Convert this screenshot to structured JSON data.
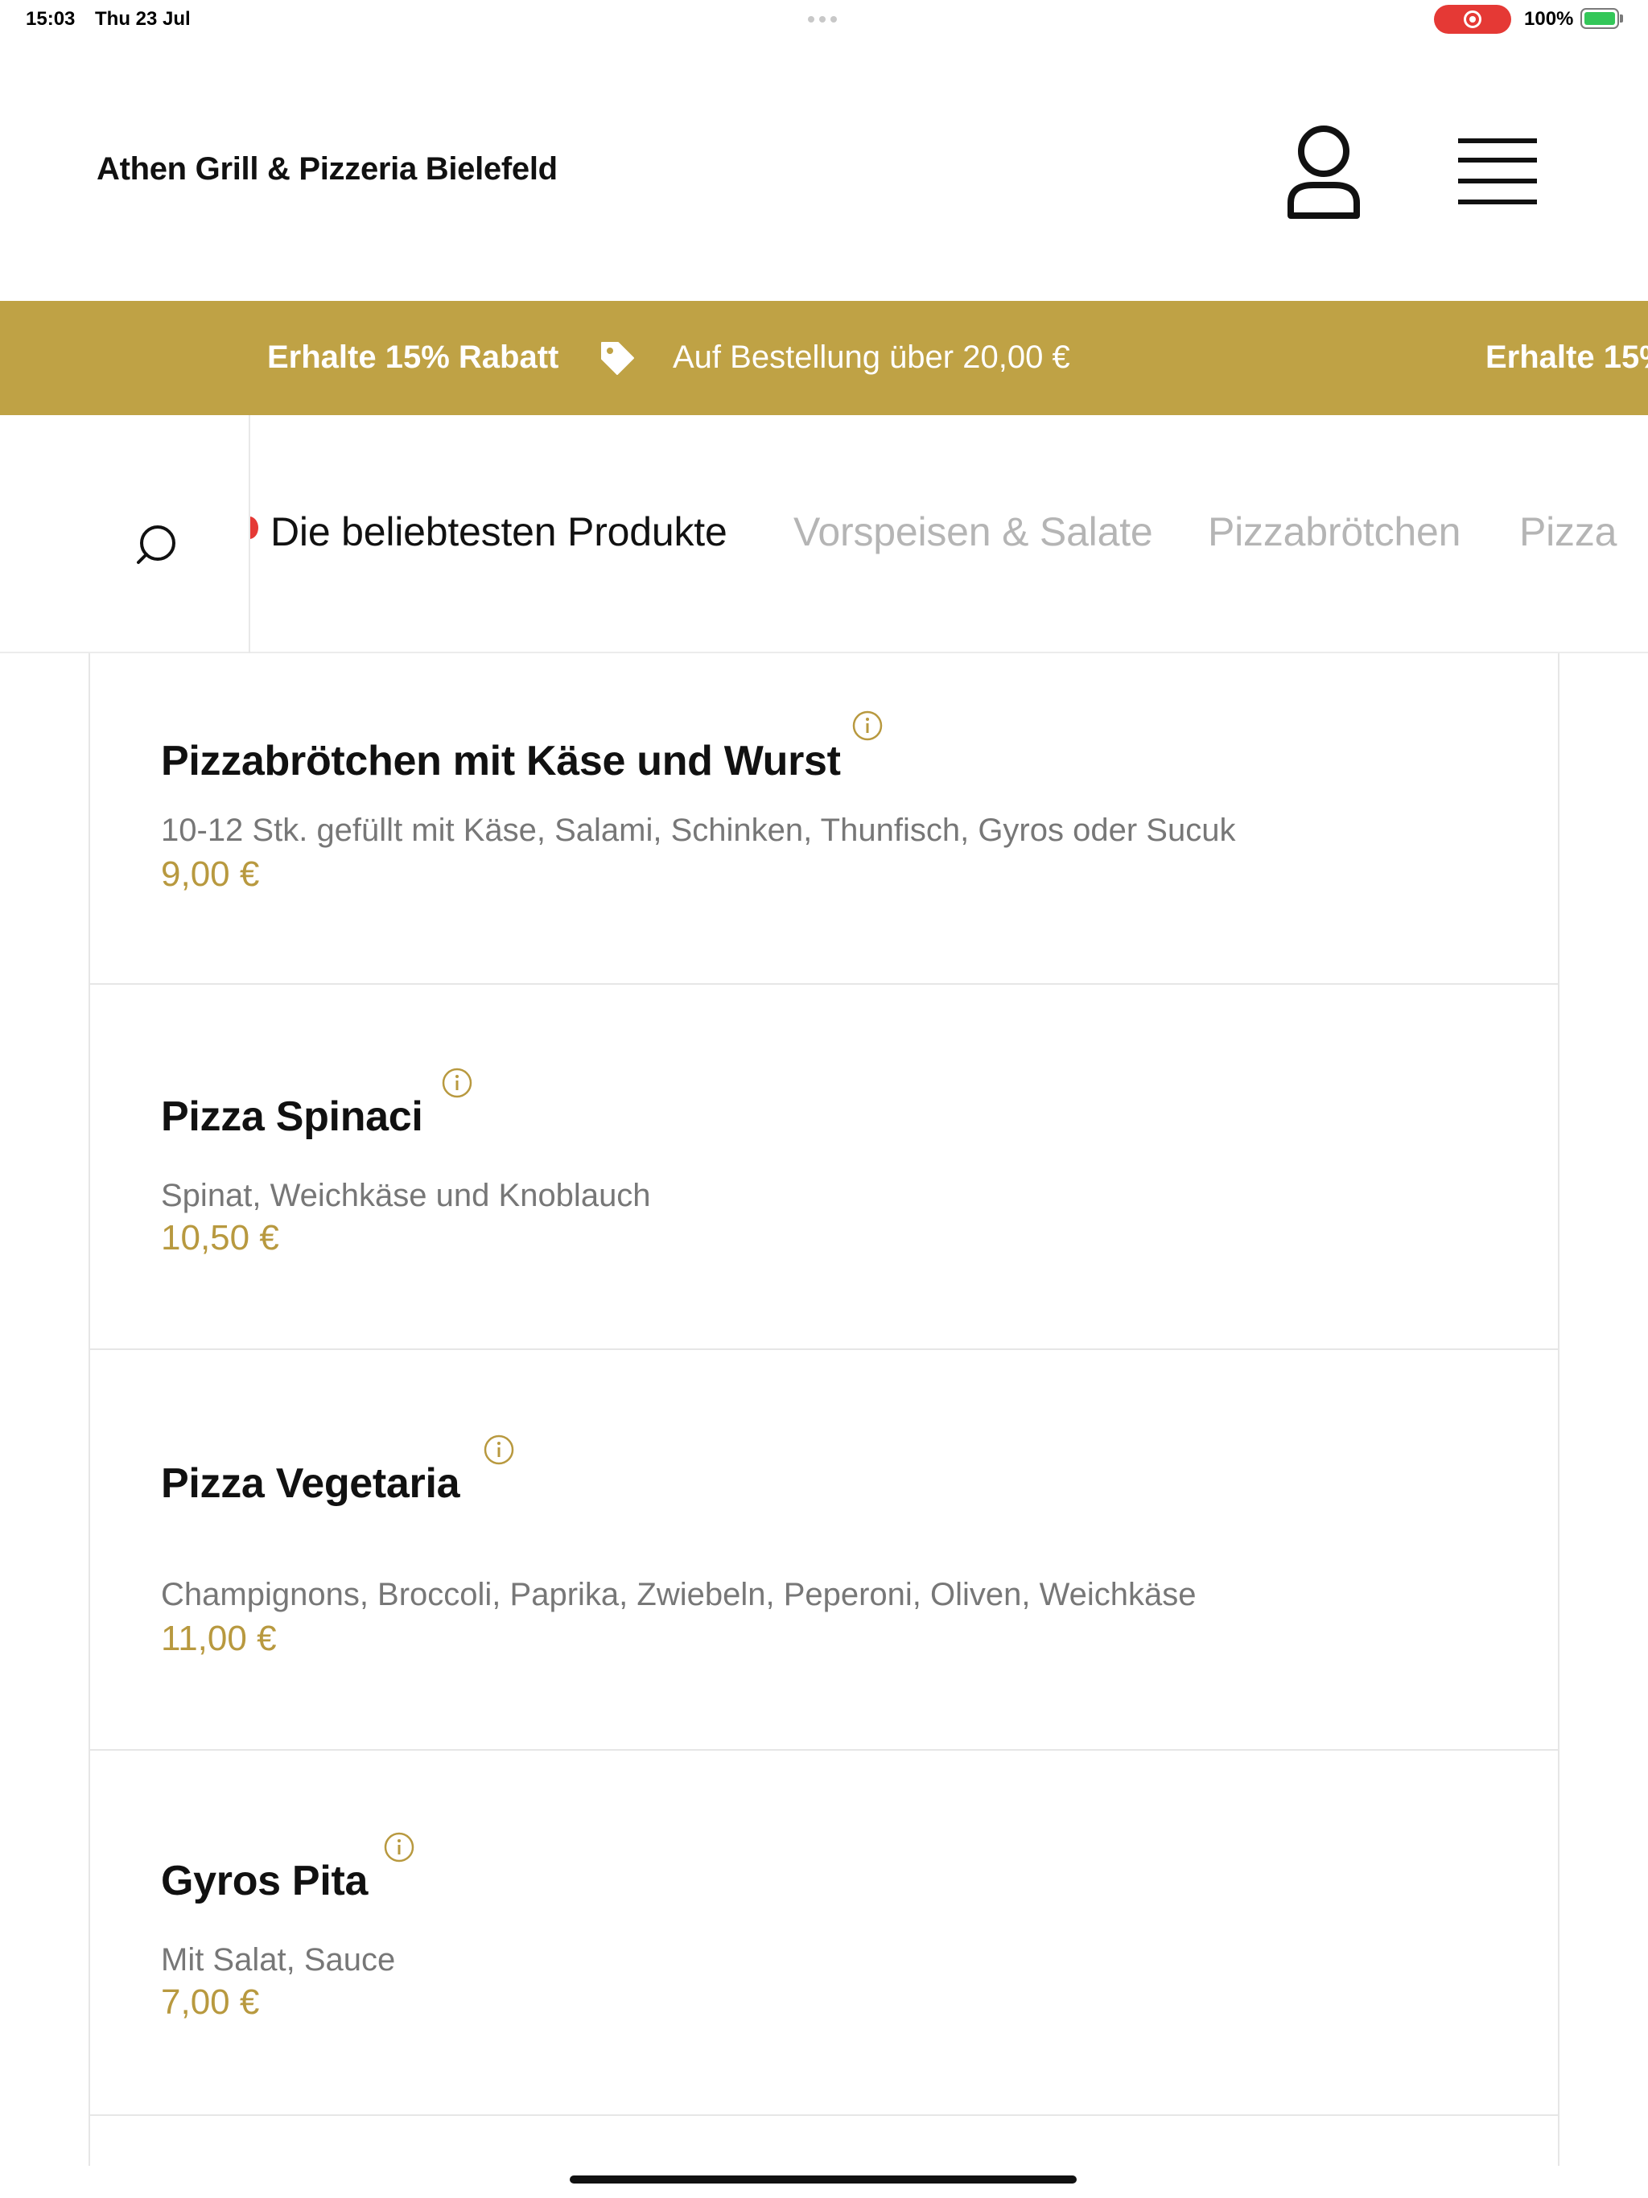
{
  "status_bar": {
    "time": "15:03",
    "date": "Thu 23 Jul",
    "battery": "100%"
  },
  "header": {
    "title": "Athen Grill & Pizzeria Bielefeld",
    "user_icon": "user-icon",
    "menu_icon": "hamburger-menu-icon"
  },
  "promo": {
    "discount": "Erhalte 15% Rabatt",
    "condition": "Auf Bestellung über 20,00 €",
    "discount_repeat": "Erhalte 15%",
    "tag_icon": "tag-icon",
    "color": "#bfa245"
  },
  "categories": {
    "search_icon": "search-icon",
    "tabs": [
      {
        "label": "Die beliebtesten Produkte",
        "active": true
      },
      {
        "label": "Vorspeisen & Salate",
        "active": false
      },
      {
        "label": "Pizzabrötchen",
        "active": false
      },
      {
        "label": "Pizza",
        "active": false
      }
    ]
  },
  "products": [
    {
      "name": "Pizzabrötchen mit Käse und Wurst",
      "description": "10-12 Stk. gefüllt mit Käse, Salami, Schinken, Thunfisch, Gyros oder Sucuk",
      "price": "9,00 €"
    },
    {
      "name": "Pizza Spinaci",
      "description": "Spinat, Weichkäse und Knoblauch",
      "price": "10,50 €"
    },
    {
      "name": "Pizza Vegetaria",
      "description": "Champignons, Broccoli, Paprika, Zwiebeln, Peperoni, Oliven, Weichkäse",
      "price": "11,00 €"
    },
    {
      "name": "Gyros Pita",
      "description": "Mit Salat, Sauce",
      "price": "7,00 €"
    }
  ],
  "colors": {
    "accent": "#bfa245",
    "price": "#b8993f",
    "inactive_tab": "#b5b5b5"
  }
}
